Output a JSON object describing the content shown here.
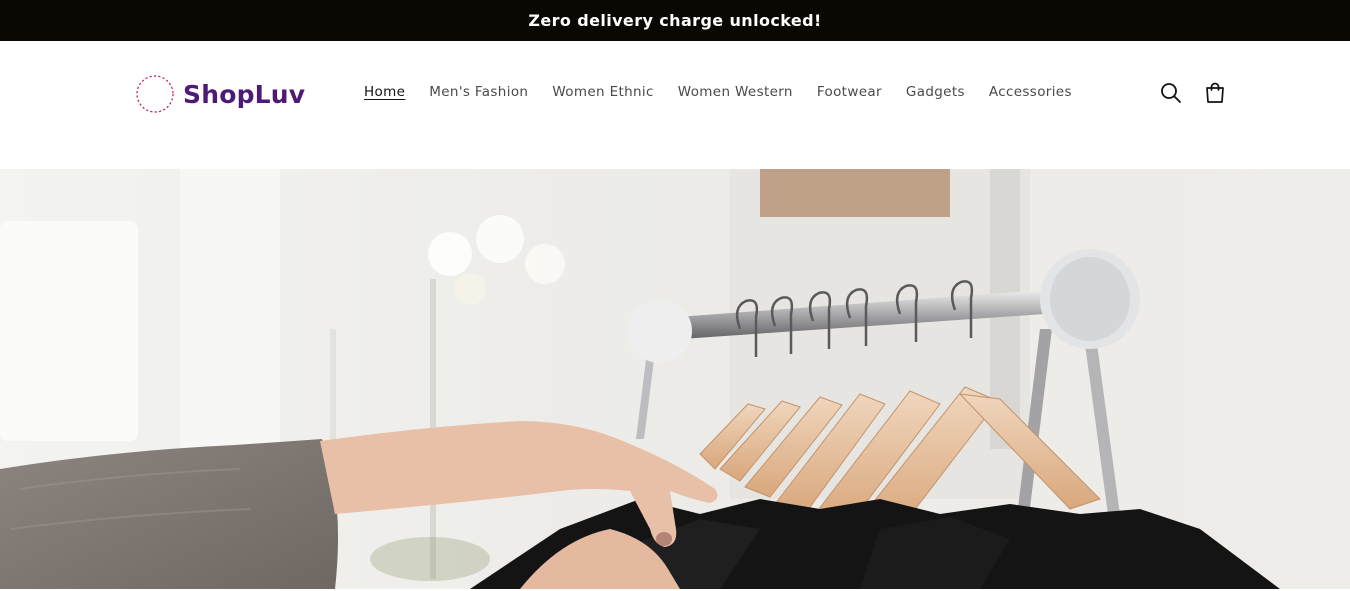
{
  "announcement": {
    "text": "Zero delivery charge unlocked!"
  },
  "header": {
    "logo_text": "ShopLuv",
    "nav": [
      {
        "label": "Home",
        "active": true
      },
      {
        "label": "Men's Fashion",
        "active": false
      },
      {
        "label": "Women Ethnic",
        "active": false
      },
      {
        "label": "Women Western",
        "active": false
      },
      {
        "label": "Footwear",
        "active": false
      },
      {
        "label": "Gadgets",
        "active": false
      },
      {
        "label": "Accessories",
        "active": false
      }
    ],
    "icons": {
      "search": "search-icon",
      "cart": "cart-icon"
    }
  },
  "hero": {
    "image": "hand-browsing-clothes-on-rack"
  },
  "colors": {
    "announcement_bg": "#0b0703",
    "brand": "#4e1a78",
    "logo_ring": "#c2185b"
  }
}
